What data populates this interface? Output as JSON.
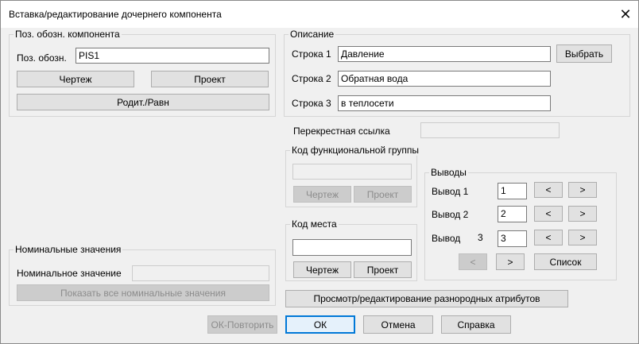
{
  "window": {
    "title": "Вставка/редактирование дочернего компонента",
    "close_glyph": "✕"
  },
  "component": {
    "legend": "Поз. обозн. компонента",
    "tag_label": "Поз. обозн.",
    "tag_value": "PIS1",
    "drawing_button": "Чертеж",
    "project_button": "Проект",
    "parent_button": "Родит./Равн"
  },
  "description": {
    "legend": "Описание",
    "line1_label": "Строка 1",
    "line1_value": "Давление",
    "line2_label": "Строка 2",
    "line2_value": "Обратная вода",
    "line3_label": "Строка 3",
    "line3_value": "в теплосети",
    "select_button": "Выбрать"
  },
  "cross_reference": {
    "label": "Перекрестная ссылка",
    "value": ""
  },
  "function_code": {
    "legend": "Код функциональной группы",
    "value": "",
    "drawing_button": "Чертеж",
    "project_button": "Проект"
  },
  "location_code": {
    "legend": "Код места",
    "value": "",
    "drawing_button": "Чертеж",
    "project_button": "Проект"
  },
  "pins": {
    "legend": "Выводы",
    "pin1_label": "Вывод 1",
    "pin1_value": "1",
    "pin2_label": "Вывод 2",
    "pin2_value": "2",
    "pin3_label": "Вывод",
    "pin3_count": "3",
    "pin3_value": "3",
    "prev_glyph": "<",
    "next_glyph": ">",
    "list_button": "Список"
  },
  "ratings": {
    "legend": "Номинальные значения",
    "value_label": "Номинальное значение",
    "value": "",
    "show_all_button": "Показать все номинальные значения"
  },
  "attributes_button": "Просмотр/редактирование разнородных атрибутов",
  "footer": {
    "ok_repeat": "ОК-Повторить",
    "ok": "ОК",
    "cancel": "Отмена",
    "help": "Справка"
  }
}
